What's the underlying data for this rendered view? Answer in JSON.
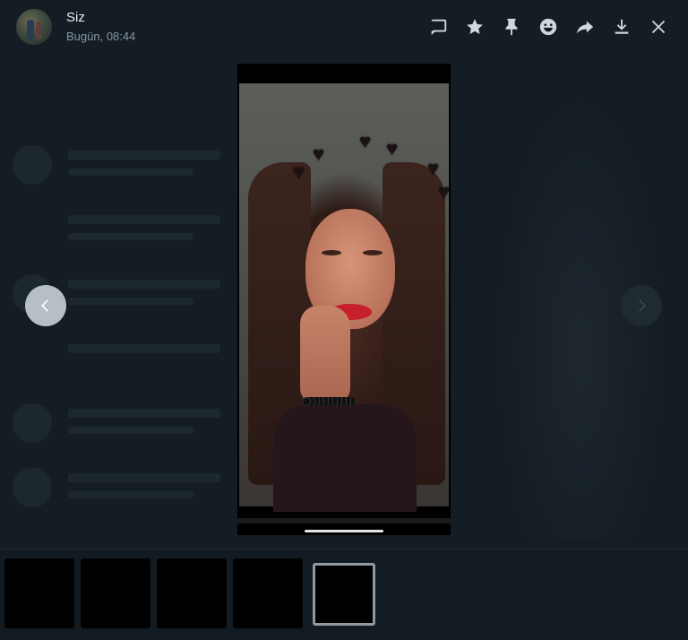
{
  "header": {
    "sender_name": "Siz",
    "timestamp": "Bugün, 08:44",
    "avatar_icon": "profile-photo"
  },
  "toolbar": {
    "buttons": [
      {
        "name": "reply-icon"
      },
      {
        "name": "star-icon"
      },
      {
        "name": "pin-icon"
      },
      {
        "name": "emoji-react-icon"
      },
      {
        "name": "forward-icon"
      },
      {
        "name": "download-icon"
      },
      {
        "name": "close-icon"
      }
    ]
  },
  "navigation": {
    "prev_icon": "chevron-left-icon",
    "next_icon": "chevron-right-icon"
  },
  "thumbnails": {
    "count": 5,
    "active_index": 4
  },
  "colors": {
    "background": "#141d24",
    "icon": "#d1d7db",
    "subtext": "#8696a0",
    "active_border": "#8f9aa1"
  }
}
